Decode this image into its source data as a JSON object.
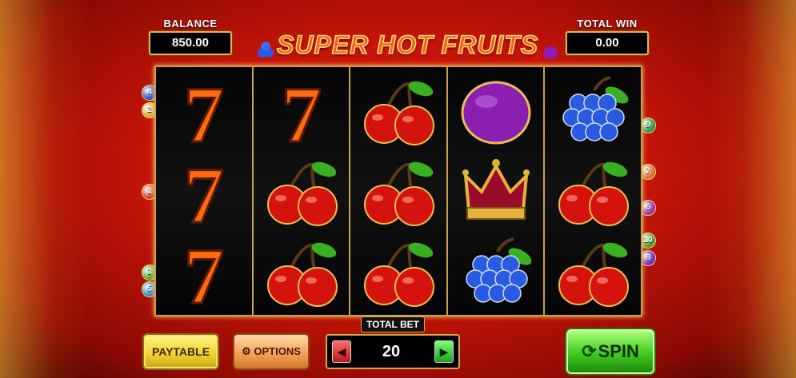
{
  "header": {
    "balance_label": "BALANCE",
    "balance_value": "850.00",
    "totalwin_label": "TOTAL WIN",
    "totalwin_value": "0.00",
    "logo_text": "SUPER HOT FRUITS"
  },
  "reels": [
    [
      "seven",
      "seven",
      "seven"
    ],
    [
      "seven",
      "cherry",
      "cherry"
    ],
    [
      "cherry",
      "cherry",
      "cherry"
    ],
    [
      "plum",
      "crown",
      "grapes"
    ],
    [
      "grapes",
      "cherry",
      "cherry"
    ]
  ],
  "paylines": {
    "left": [
      {
        "n": "4"
      },
      {
        "n": "2"
      },
      {
        "n": "1"
      },
      {
        "n": "3"
      },
      {
        "n": "5"
      }
    ],
    "right": [
      {
        "n": "9"
      },
      {
        "n": "7"
      },
      {
        "n": "6"
      },
      {
        "n": "10"
      },
      {
        "n": "8"
      }
    ]
  },
  "controls": {
    "paytable_label": "PAYTABLE",
    "options_label": "OPTIONS",
    "total_bet_label": "TOTAL BET",
    "total_bet_value": "20",
    "spin_label": "SPIN"
  },
  "colors": {
    "seven": "#ff6a10",
    "cherry": "#d4140c",
    "plum": "#8a1fb0",
    "grapes": "#2a5ae0",
    "crown": "#e2b23a",
    "leaf": "#3ab020"
  }
}
